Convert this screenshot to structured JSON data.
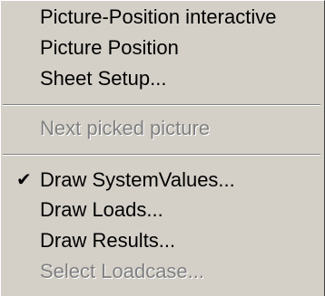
{
  "menu": {
    "items": [
      {
        "label": "Picture-Position interactive",
        "enabled": true,
        "checked": false
      },
      {
        "label": "Picture Position",
        "enabled": true,
        "checked": false
      },
      {
        "label": "Sheet Setup...",
        "enabled": true,
        "checked": false
      },
      {
        "label": "Next picked picture",
        "enabled": false,
        "checked": false
      },
      {
        "label": "Draw SystemValues...",
        "enabled": true,
        "checked": true
      },
      {
        "label": "Draw Loads...",
        "enabled": true,
        "checked": false
      },
      {
        "label": "Draw Results...",
        "enabled": true,
        "checked": false
      },
      {
        "label": "Select Loadcase...",
        "enabled": false,
        "checked": false
      }
    ],
    "check_glyph": "✔"
  }
}
